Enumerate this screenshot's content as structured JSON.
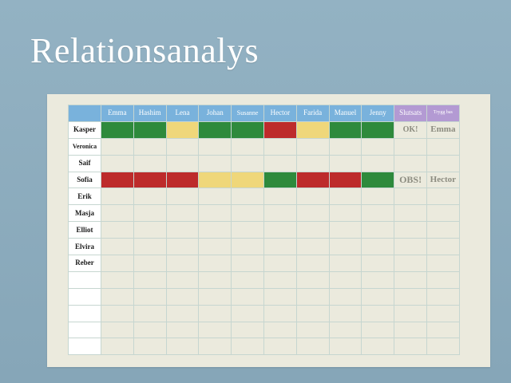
{
  "title": "Relationsanalys",
  "columns": [
    "Emma",
    "Hashim",
    "Lena",
    "Johan",
    "Susanne",
    "Hector",
    "Farida",
    "Manuel",
    "Jenny"
  ],
  "summary_columns": [
    "Slutsats",
    "Trygg bas"
  ],
  "rows": [
    {
      "name": "Kasper",
      "cells": [
        "green",
        "green",
        "yellow",
        "green",
        "green",
        "red",
        "yellow",
        "green",
        "green"
      ],
      "slutsats": "OK!",
      "trygg_bas": "Emma"
    },
    {
      "name": "Veronica",
      "cells": [],
      "slutsats": "",
      "trygg_bas": ""
    },
    {
      "name": "Saif",
      "cells": [],
      "slutsats": "",
      "trygg_bas": ""
    },
    {
      "name": "Sofia",
      "cells": [
        "red",
        "red",
        "red",
        "yellow",
        "yellow",
        "green",
        "red",
        "red",
        "green"
      ],
      "slutsats": "OBS!",
      "trygg_bas": "Hector"
    },
    {
      "name": "Erik",
      "cells": [],
      "slutsats": "",
      "trygg_bas": ""
    },
    {
      "name": "Masja",
      "cells": [],
      "slutsats": "",
      "trygg_bas": ""
    },
    {
      "name": "Elliot",
      "cells": [],
      "slutsats": "",
      "trygg_bas": ""
    },
    {
      "name": "Elvira",
      "cells": [],
      "slutsats": "",
      "trygg_bas": ""
    },
    {
      "name": "Reber",
      "cells": [],
      "slutsats": "",
      "trygg_bas": ""
    },
    {
      "name": "",
      "cells": [],
      "slutsats": "",
      "trygg_bas": ""
    },
    {
      "name": "",
      "cells": [],
      "slutsats": "",
      "trygg_bas": ""
    },
    {
      "name": "",
      "cells": [],
      "slutsats": "",
      "trygg_bas": ""
    },
    {
      "name": "",
      "cells": [],
      "slutsats": "",
      "trygg_bas": ""
    },
    {
      "name": "",
      "cells": [],
      "slutsats": "",
      "trygg_bas": ""
    }
  ],
  "colors": {
    "green": "#2e8a3c",
    "yellow": "#efd77a",
    "red": "#bd2b2b",
    "header_blue": "#79b2dc",
    "header_purple": "#b39ad3",
    "background": "#8aaabb",
    "paper": "#ebeadd"
  }
}
